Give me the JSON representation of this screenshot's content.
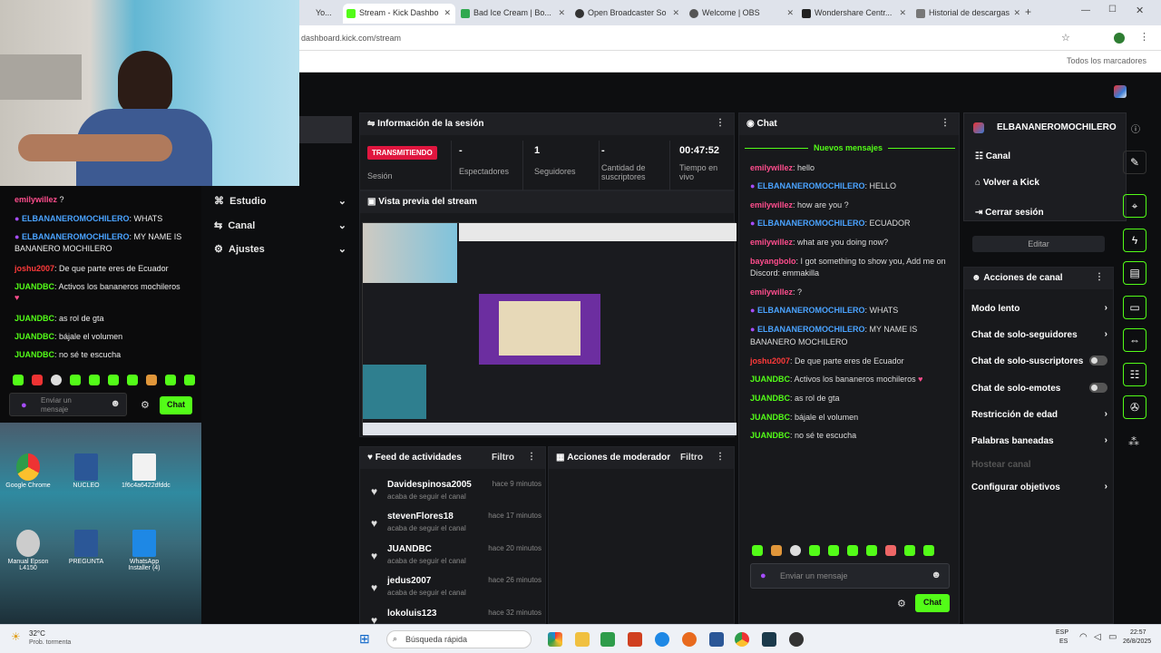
{
  "browser": {
    "tabs": [
      {
        "label": "Yo..."
      },
      {
        "label": "Stream - Kick Dashbo"
      },
      {
        "label": "Bad Ice Cream | Bo..."
      },
      {
        "label": "Open Broadcaster So"
      },
      {
        "label": "Welcome | OBS"
      },
      {
        "label": "Wondershare Centr..."
      },
      {
        "label": "Historial de descargas"
      }
    ],
    "url": "dashboard.kick.com/stream",
    "bookmarks_all": "Todos los marcadores"
  },
  "nav": {
    "estudio": "Estudio",
    "canal": "Canal",
    "ajustes": "Ajustes"
  },
  "session": {
    "title": "Información de la sesión",
    "live_badge": "TRANSMITIENDO",
    "session_label": "Sesión",
    "stats": [
      {
        "value": "-",
        "label": "Espectadores"
      },
      {
        "value": "1",
        "label": "Seguidores"
      },
      {
        "value": "-",
        "label": "Cantidad de suscriptores"
      },
      {
        "value": "00:47:52",
        "label": "Tiempo en vivo"
      }
    ]
  },
  "preview": {
    "title": "Vista previa del stream"
  },
  "feed": {
    "title": "Feed de actividades",
    "filter": "Filtro",
    "items": [
      {
        "name": "Davidespinosa2005",
        "action": "acaba de seguir el canal",
        "time": "hace 9 minutos"
      },
      {
        "name": "stevenFlores18",
        "action": "acaba de seguir el canal",
        "time": "hace 17 minutos"
      },
      {
        "name": "JUANDBC",
        "action": "acaba de seguir el canal",
        "time": "hace 20 minutos"
      },
      {
        "name": "jedus2007",
        "action": "acaba de seguir el canal",
        "time": "hace 26 minutos"
      },
      {
        "name": "lokoluis123",
        "action": "",
        "time": "hace 32 minutos"
      }
    ]
  },
  "mod": {
    "title": "Acciones de moderador",
    "filter": "Filtro"
  },
  "chat": {
    "title": "Chat",
    "new_messages": "Nuevos mensajes",
    "messages": [
      {
        "user": "emilywillez",
        "text": "hello"
      },
      {
        "user": "ELBANANEROMOCHILERO",
        "text": "HELLO"
      },
      {
        "user": "emilywillez",
        "text": "how are you ?"
      },
      {
        "user": "ELBANANEROMOCHILERO",
        "text": "ECUADOR"
      },
      {
        "user": "emilywillez",
        "text": "what are you doing now?"
      },
      {
        "user": "bayangbolo",
        "text": "I got something to show you, Add me on"
      },
      {
        "user": "",
        "text": "Discord: emmakilla"
      },
      {
        "user": "emilywillez",
        "text": "?"
      },
      {
        "user": "ELBANANEROMOCHILERO",
        "text": "WHATS"
      },
      {
        "user": "ELBANANEROMOCHILERO",
        "text": "MY NAME IS"
      },
      {
        "user": "",
        "text": "BANANERO MOCHILERO"
      },
      {
        "user": "joshu2007",
        "text": "De que parte eres de Ecuador"
      },
      {
        "user": "JUANDBC",
        "text": "Activos los bananeros mochileros"
      },
      {
        "user": "JUANDBC",
        "text": "as rol de gta"
      },
      {
        "user": "JUANDBC",
        "text": "bájale el volumen"
      },
      {
        "user": "JUANDBC",
        "text": "no sé te escucha"
      }
    ],
    "placeholder": "Enviar un mensaje",
    "send": "Chat"
  },
  "channel": {
    "name": "ELBANANEROMOCHILERO",
    "menu": [
      "Canal",
      "Volver a Kick",
      "Cerrar sesión"
    ],
    "edit": "Editar",
    "actions_title": "Acciones de canal",
    "actions": [
      "Modo lento",
      "Chat de solo-seguidores",
      "Chat de solo-suscriptores",
      "Chat de solo-emotes",
      "Restricción de edad",
      "Palabras baneadas",
      "Hostear canal",
      "Configurar objetivos"
    ]
  },
  "overlay_chat": {
    "lines": [
      {
        "user": "emilywillez",
        "text": "?"
      },
      {
        "user": "ELBANANEROMOCHILERO",
        "text": "WHATS"
      },
      {
        "user": "ELBANANEROMOCHILERO",
        "text": "MY NAME IS"
      },
      {
        "user": "",
        "text": "BANANERO MOCHILERO"
      },
      {
        "user": "joshu2007",
        "text": "De que parte eres de Ecuador"
      },
      {
        "user": "JUANDBC",
        "text": "Activos los bananeros mochileros"
      },
      {
        "user": "JUANDBC",
        "text": "as rol de gta"
      },
      {
        "user": "JUANDBC",
        "text": "bájale el volumen"
      },
      {
        "user": "JUANDBC",
        "text": "no sé te escucha"
      }
    ],
    "placeholder": "Enviar un mensaje",
    "send": "Chat"
  },
  "desktop": {
    "icons": [
      "Google Chrome",
      "NUCLEO",
      "1f6c4a6422dfddc",
      "Manual Epson L4150",
      "PREGUNTA",
      "WhatsApp Installer (4)"
    ]
  },
  "taskbar": {
    "weather": "32°C",
    "weather_sub": "Prob. tormenta",
    "search": "Búsqueda rápida",
    "lang": "ESP",
    "lang_sub": "ES",
    "time": "22:57",
    "date": "26/8/2025"
  },
  "colors": {
    "accent": "#53fc18",
    "live": "#e0163f",
    "panel": "#18191c"
  }
}
